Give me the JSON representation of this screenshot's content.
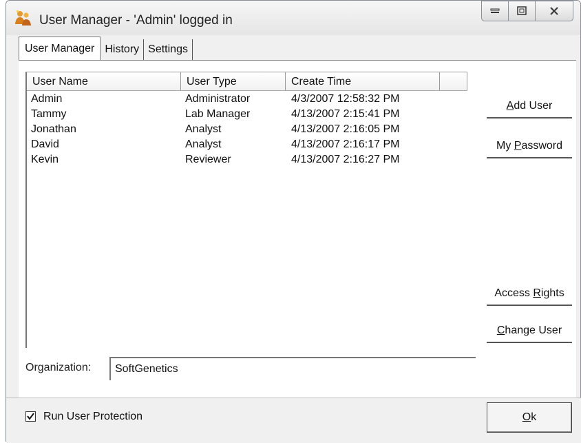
{
  "window": {
    "title": "User Manager - 'Admin' logged in",
    "icon": "user-manager-app-icon"
  },
  "tabs": [
    {
      "label": "User Manager",
      "active": true
    },
    {
      "label": "History",
      "active": false
    },
    {
      "label": "Settings",
      "active": false
    }
  ],
  "table": {
    "headers": [
      "User Name",
      "User Type",
      "Create Time"
    ],
    "rows": [
      [
        "Admin",
        "Administrator",
        "4/3/2007 12:58:32 PM"
      ],
      [
        "Tammy",
        "Lab Manager",
        "4/13/2007 2:15:41 PM"
      ],
      [
        "Jonathan",
        "Analyst",
        "4/13/2007 2:16:05 PM"
      ],
      [
        "David",
        "Analyst",
        "4/13/2007 2:16:17 PM"
      ],
      [
        "Kevin",
        "Reviewer",
        "4/13/2007 2:16:27 PM"
      ]
    ]
  },
  "buttons": {
    "add_user": {
      "pre": "",
      "mnemonic": "A",
      "post": "dd User"
    },
    "my_password": {
      "pre": "My ",
      "mnemonic": "P",
      "post": "assword"
    },
    "access_rights": {
      "pre": "Access ",
      "mnemonic": "R",
      "post": "ights"
    },
    "change_user": {
      "pre": "",
      "mnemonic": "C",
      "post": "hange User"
    },
    "ok": {
      "pre": "",
      "mnemonic": "O",
      "post": "k"
    }
  },
  "organization": {
    "label": "Organization:",
    "value": "SoftGenetics"
  },
  "protection": {
    "label": "Run User Protection",
    "checked": true
  }
}
